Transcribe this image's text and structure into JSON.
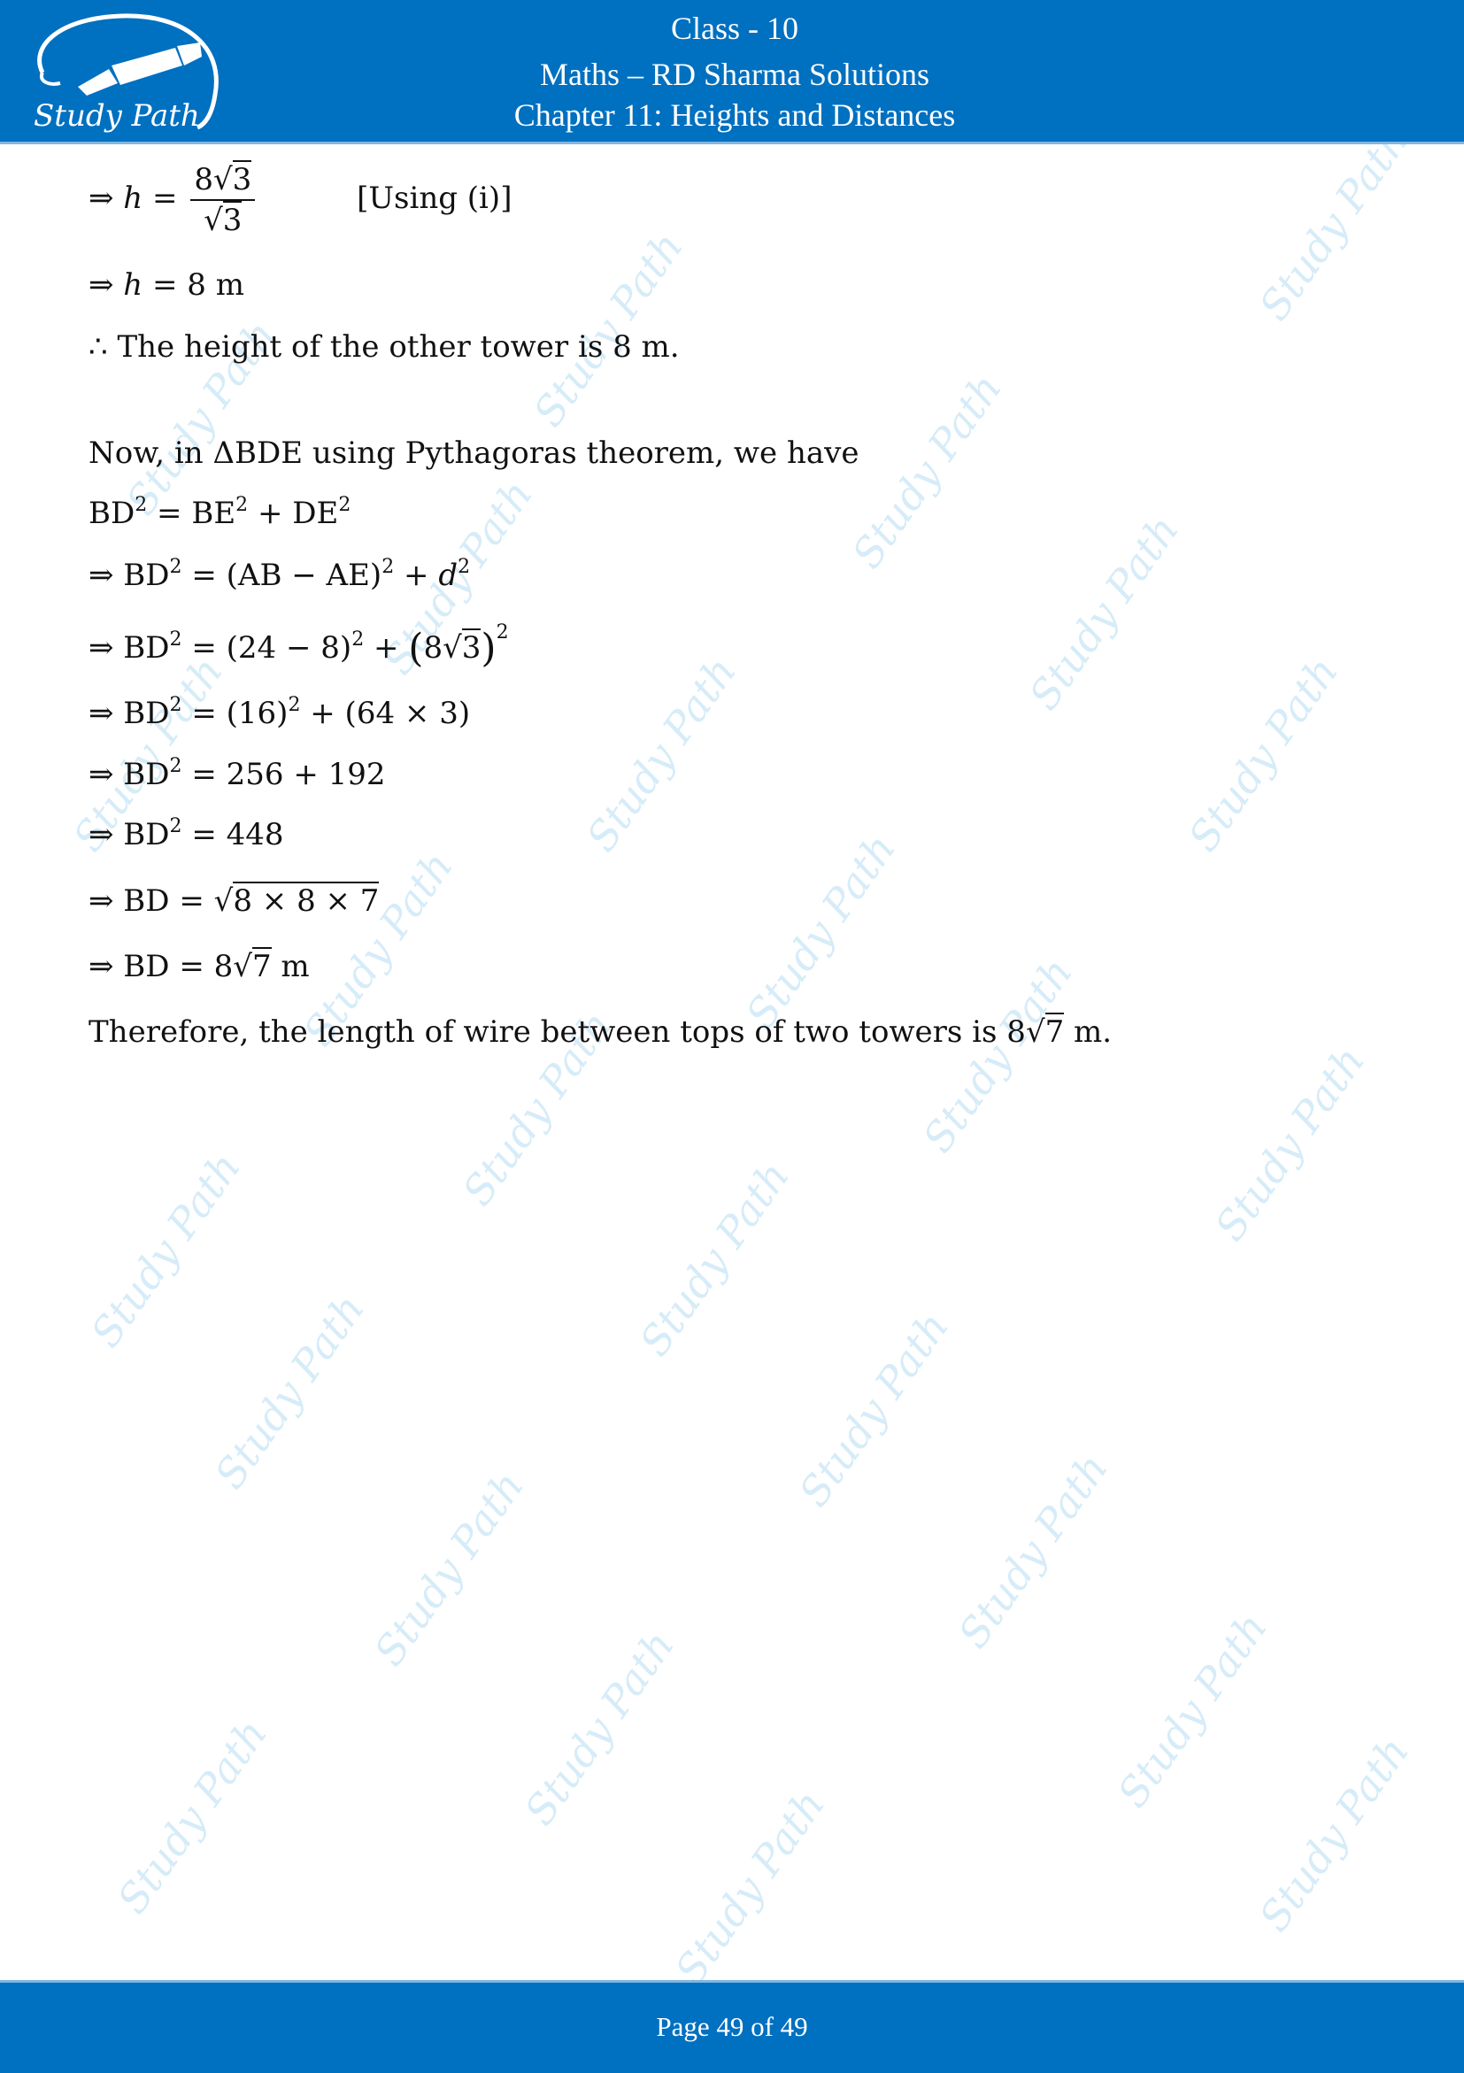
{
  "header": {
    "logo_text": "Study Path",
    "class_label": "Class - 10",
    "subject": "Maths – RD Sharma Solutions",
    "chapter": "Chapter 11: Heights and Distances",
    "background_color": "#0070c0"
  },
  "content": {
    "step1": {
      "prefix": "⇒ ",
      "var": "h",
      "eq": " = ",
      "num_coef": "8",
      "num_rad": "3",
      "den_rad": "3",
      "note": "[Using (i)]"
    },
    "step2": {
      "prefix": "⇒ ",
      "var": "h",
      "rest": " = 8 m"
    },
    "conclusion1": "∴ The height of the other tower is 8 m.",
    "intro": "Now, in ΔBDE using Pythagoras theorem, we have",
    "eq1": {
      "a": "BD",
      "b": " = BE",
      "c": " + DE",
      "exp": "2"
    },
    "eq2": {
      "prefix": "⇒ BD",
      "mid": " = (AB − AE)",
      "plus": " + ",
      "var": "d",
      "exp": "2"
    },
    "eq3": {
      "prefix": "⇒ BD",
      "mid": " = (24 − 8)",
      "plus": " + ",
      "coef": "8",
      "rad": "3",
      "exp": "2"
    },
    "eq4": {
      "prefix": "⇒ BD",
      "mid": " = (16)",
      "rest": " + (64 × 3)",
      "exp": "2"
    },
    "eq5": {
      "prefix": "⇒ BD",
      "rest": " = 256 + 192",
      "exp": "2"
    },
    "eq6": {
      "prefix": "⇒ BD",
      "rest": " = 448",
      "exp": "2"
    },
    "eq7": {
      "prefix": "⇒ BD = ",
      "rad": "8 × 8 × 7"
    },
    "eq8": {
      "prefix": "⇒ BD = 8",
      "rad": "7",
      "unit": " m"
    },
    "final": {
      "text": "Therefore, the length of wire between tops of two towers is 8",
      "rad": "7",
      "unit": " m."
    }
  },
  "watermark": "Study Path",
  "footer": {
    "page_label": "Page 49 of 49"
  }
}
